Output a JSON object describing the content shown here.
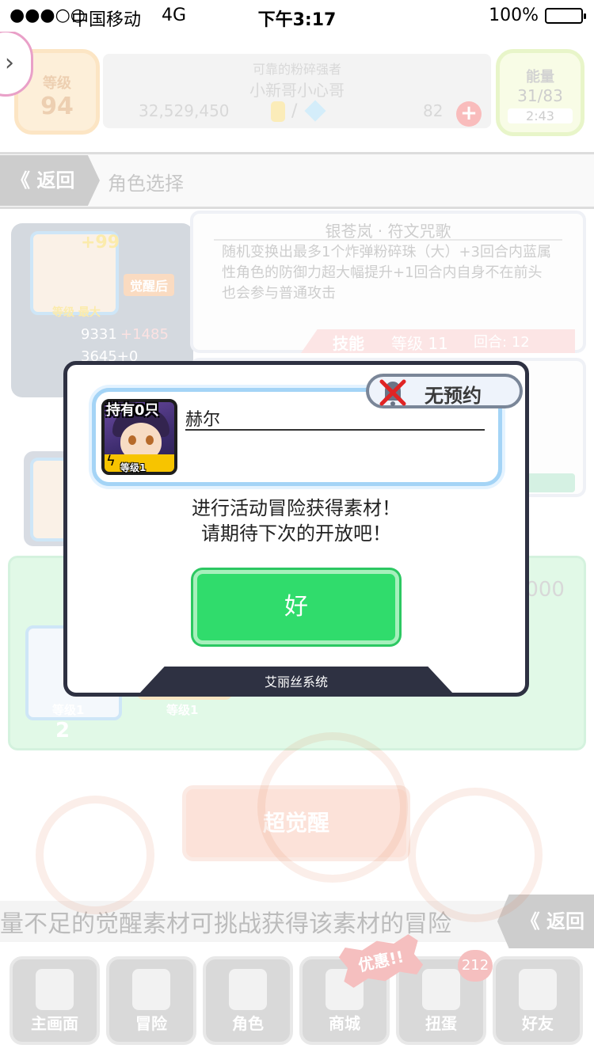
{
  "status_bar": {
    "signal": "●●●○○",
    "carrier": "中国移动",
    "network": "4G",
    "time": "下午3:17",
    "battery": "100%"
  },
  "header": {
    "level_label": "等级",
    "level_value": "94",
    "title": "可靠的粉碎强者",
    "name": "小新哥小心哥",
    "coins": "32,529,450",
    "slash": "/",
    "gems": "82",
    "plus": "+",
    "energy_label": "能量",
    "energy_value": "31/83",
    "energy_timer": "2:43"
  },
  "nav": {
    "back_label": "返回",
    "back_chevron": "《",
    "title": "角色选择"
  },
  "character": {
    "plus": "+99",
    "awaken_tag": "觉醒后",
    "level_max": "等级 最大",
    "hp": "9331",
    "hp_bonus": "+1485",
    "atk": "3645+0"
  },
  "skill": {
    "title": "银苍岚 · 符文咒歌",
    "description": "随机变换出最多1个炸弹粉碎珠（大）+3回合内蓝属性角色的防御力超大幅提升+1回合内自身不在前头也会参与普通攻击",
    "label": "技能",
    "level_label": "等级",
    "level": "11",
    "turns_label": "回合:",
    "turns": "12"
  },
  "materials": {
    "price": "10,000",
    "slot1_level": "等级1",
    "slot2_level": "等级1",
    "count": "2"
  },
  "super_awaken": "超觉醒",
  "marquee": "量不足的觉醒素材可挑战获得该素材的冒险",
  "back2_label": "返回",
  "tabs": [
    {
      "label": "主画面",
      "icon": "home-icon"
    },
    {
      "label": "冒险",
      "icon": "handshake-icon"
    },
    {
      "label": "角色",
      "icon": "rabbit-icon"
    },
    {
      "label": "商城",
      "icon": "cart-icon"
    },
    {
      "label": "扭蛋",
      "icon": "egg-icon"
    },
    {
      "label": "好友",
      "icon": "friends-icon"
    }
  ],
  "badge_count": "212",
  "promo_label": "优惠!!",
  "dialog": {
    "own_label": "持有0只",
    "item_level": "等级1",
    "item_name": "赫尔",
    "no_reservation": "无预约",
    "message_line1": "进行活动冒险获得素材！",
    "message_line2": "请期待下次的开放吧！",
    "ok_label": "好",
    "footer": "艾丽丝系统"
  },
  "colors": {
    "ok_green": "#30dc6c",
    "dialog_border": "#2e3142",
    "badge_red": "#e23a3a"
  }
}
